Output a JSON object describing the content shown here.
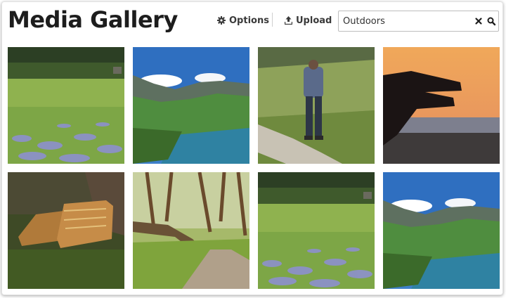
{
  "header": {
    "title": "Media Gallery",
    "options_label": "Options",
    "upload_label": "Upload"
  },
  "search": {
    "value": "Outdoors",
    "clear_icon": "close-icon",
    "search_icon": "search-icon"
  },
  "icons": {
    "options": "gear-icon",
    "upload": "upload-icon"
  },
  "gallery": {
    "images": [
      {
        "subject": "meadow"
      },
      {
        "subject": "mountain-lake"
      },
      {
        "subject": "hiker"
      },
      {
        "subject": "sunset-hand"
      },
      {
        "subject": "boots"
      },
      {
        "subject": "forest-path"
      },
      {
        "subject": "meadow"
      },
      {
        "subject": "mountain-lake"
      }
    ]
  }
}
